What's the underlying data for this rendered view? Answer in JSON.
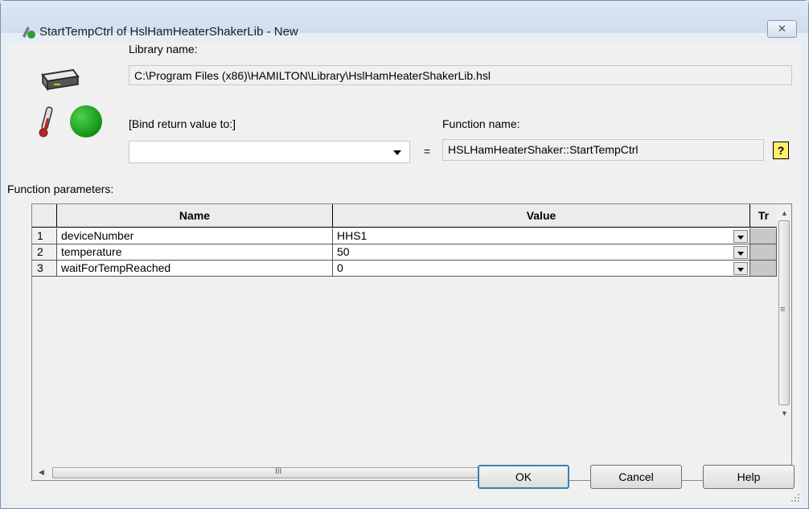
{
  "window": {
    "title": "StartTempCtrl of HslHamHeaterShakerLib - New",
    "close_label": "✕"
  },
  "library": {
    "label": "Library name:",
    "value": "C:\\Program Files (x86)\\HAMILTON\\Library\\HslHamHeaterShakerLib.hsl"
  },
  "bind": {
    "label": "[Bind return value to:]",
    "value": "",
    "equals": "="
  },
  "function": {
    "label": "Function name:",
    "value": "HSLHamHeaterShaker::StartTempCtrl",
    "help_glyph": "?"
  },
  "params": {
    "label": "Function parameters:",
    "columns": {
      "name": "Name",
      "value": "Value",
      "tr": "Tr"
    },
    "rows": [
      {
        "num": "1",
        "name": "deviceNumber",
        "value": "HHS1"
      },
      {
        "num": "2",
        "name": "temperature",
        "value": "50"
      },
      {
        "num": "3",
        "name": "waitForTempReached",
        "value": "0"
      }
    ],
    "hscroll_grip": "III",
    "vscroll_grip": "≡"
  },
  "buttons": {
    "ok": "OK",
    "cancel": "Cancel",
    "help": "Help"
  }
}
